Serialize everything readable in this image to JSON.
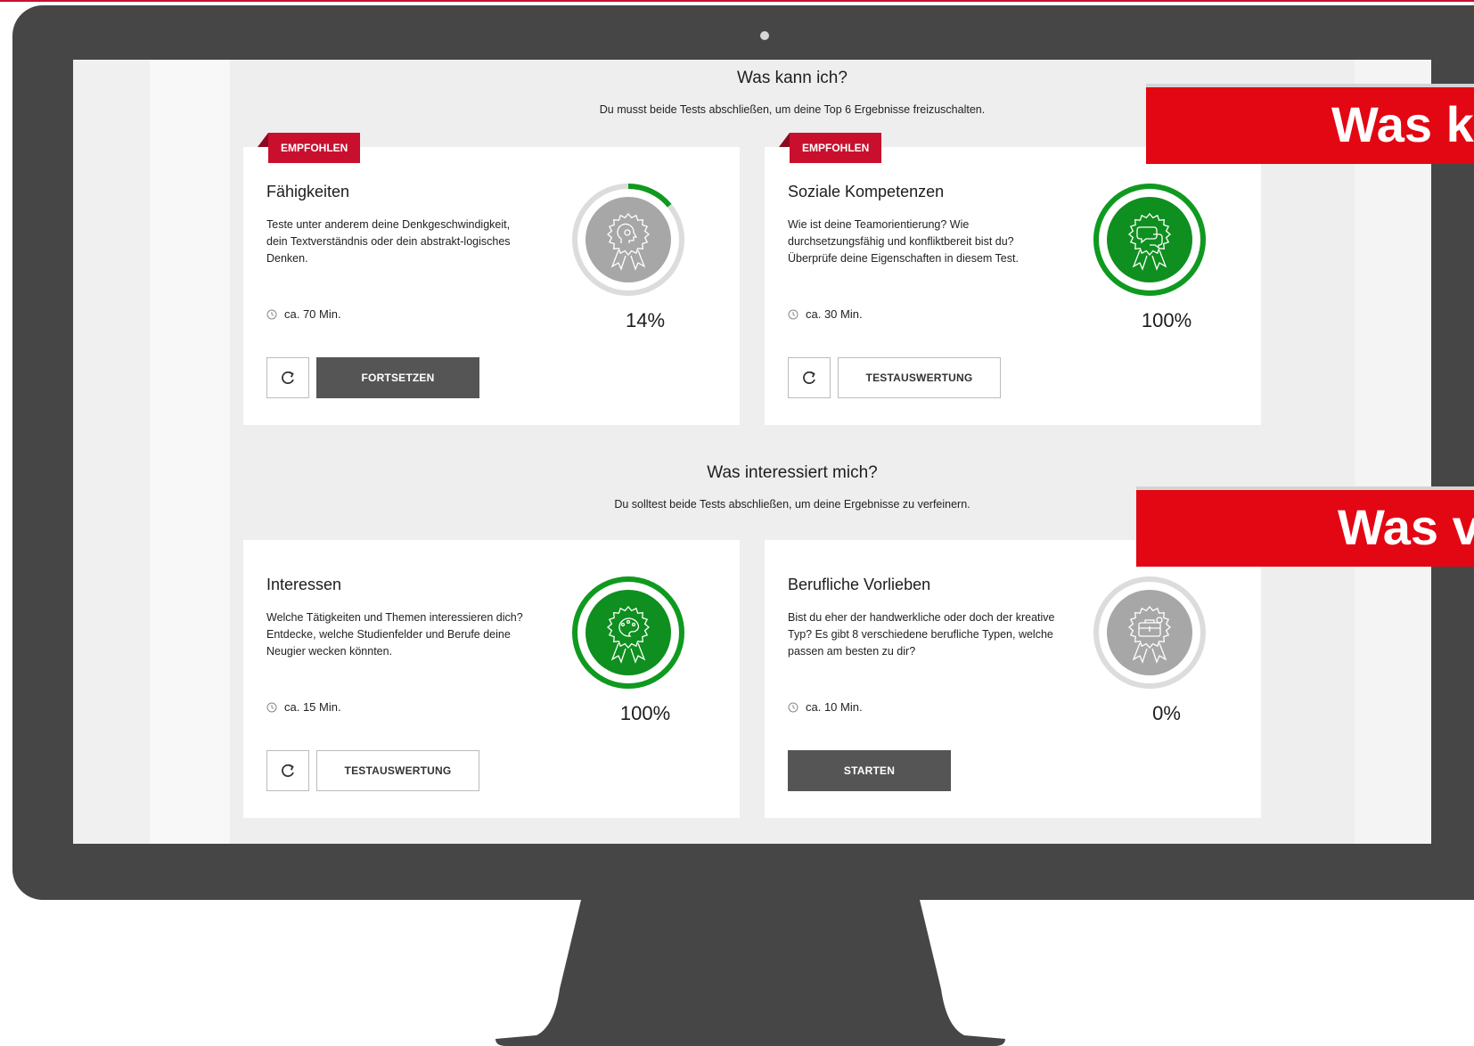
{
  "banners": [
    "Was k",
    "Was v"
  ],
  "sections": [
    {
      "title": "Was kann ich?",
      "subtitle": "Du musst beide Tests abschließen, um deine Top 6 Ergebnisse freizuschalten."
    },
    {
      "title": "Was interessiert mich?",
      "subtitle": "Du solltest beide Tests abschließen, um deine Ergebnisse zu verfeinern."
    }
  ],
  "cards": [
    {
      "badge": "EMPFOHLEN",
      "title": "Fähigkeiten",
      "description": "Teste unter anderem deine Denkgeschwindigkeit, dein Textverständnis oder dein abstrakt-logisches Denken.",
      "duration": "ca. 70 Min.",
      "progress_label": "14%",
      "progress": 0.14,
      "ring_fill": "#a7a7a7",
      "icon": "brain-award-icon",
      "action_label": "FORTSETZEN",
      "action_style": "dark"
    },
    {
      "badge": "EMPFOHLEN",
      "title": "Soziale Kompetenzen",
      "description": "Wie ist deine Teamorientierung? Wie durchsetzungsfähig und konfliktbereit bist du? Überprüfe deine Eigenschaften in diesem Test.",
      "duration": "ca. 30 Min.",
      "progress_label": "100%",
      "progress": 1.0,
      "ring_fill": "#0f8f1f",
      "icon": "chat-bubbles-award-icon",
      "action_label": "TESTAUSWERTUNG",
      "action_style": "outline"
    },
    {
      "title": "Interessen",
      "description": "Welche Tätigkeiten und Themen interessieren dich? Entdecke, welche Studienfelder und Berufe deine Neugier wecken könnten.",
      "duration": "ca. 15 Min.",
      "progress_label": "100%",
      "progress": 1.0,
      "ring_fill": "#0f8f1f",
      "icon": "palette-award-icon",
      "action_label": "TESTAUSWERTUNG",
      "action_style": "outline"
    },
    {
      "title": "Berufliche Vorlieben",
      "description": "Bist du eher der handwerkliche oder doch der kreative Typ? Es gibt 8 verschiedene berufliche Typen, welche passen am besten zu dir?",
      "duration": "ca. 10 Min.",
      "progress_label": "0%",
      "progress": 0.0,
      "ring_fill": "#a7a7a7",
      "icon": "briefcase-award-icon",
      "action_label": "STARTEN",
      "action_style": "dark"
    }
  ],
  "colors": {
    "accent_red": "#c8102e",
    "banner_red": "#e30613",
    "success_green": "#0f8f1f",
    "neutral_gray": "#a7a7a7",
    "monitor_frame": "#464646"
  }
}
